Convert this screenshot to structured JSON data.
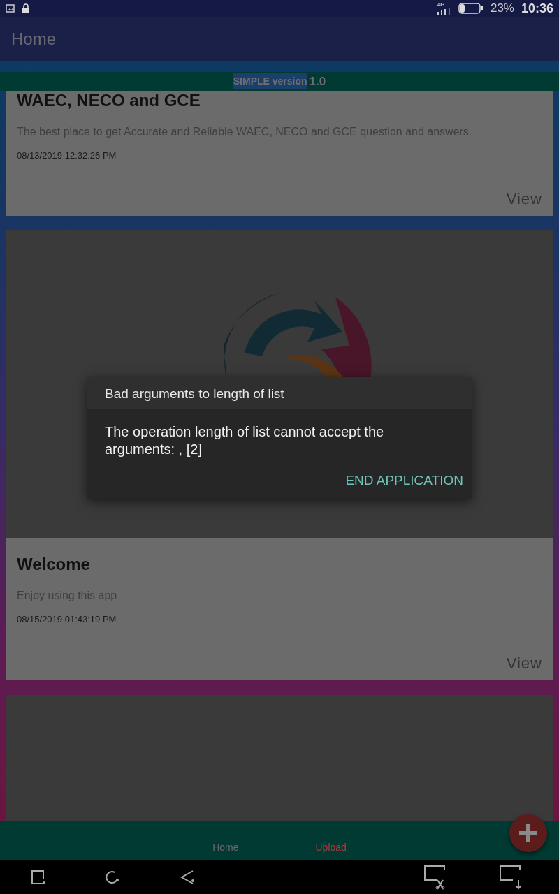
{
  "status_bar": {
    "network": "4G",
    "battery": "23%",
    "time": "10:36"
  },
  "app_bar": {
    "title": "Home"
  },
  "version_banner": {
    "label": "SIMPLE version",
    "number": "1.0"
  },
  "posts": [
    {
      "kind": "text",
      "title": "WAEC, NECO and GCE",
      "body": "The best place to get Accurate and Reliable  WAEC, NECO and GCE question and answers.",
      "date": "08/13/2019 12:32:26 PM",
      "action": "View"
    },
    {
      "kind": "image",
      "title": "Welcome",
      "body": "Enjoy using this app",
      "date": "08/15/2019 01:43:19 PM",
      "action": "View"
    },
    {
      "kind": "blank"
    }
  ],
  "dialog": {
    "title": "Bad arguments to length of list",
    "message": "The operation length of list cannot accept the arguments: , [2]",
    "button": "END APPLICATION"
  },
  "bottom_nav": [
    {
      "label": "Home",
      "color": "#6a6a6a"
    },
    {
      "label": "Upload",
      "color": "#b03a3a"
    }
  ]
}
